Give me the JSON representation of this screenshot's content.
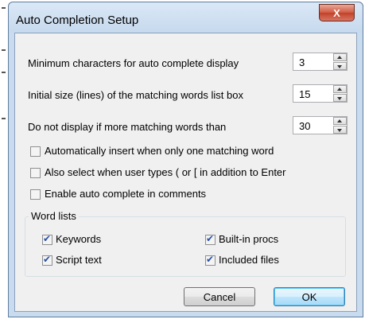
{
  "window": {
    "title": "Auto Completion Setup",
    "close_glyph": "X"
  },
  "settings": [
    {
      "label": "Minimum characters for auto complete display",
      "value": "3"
    },
    {
      "label": "Initial size (lines) of the matching words list box",
      "value": "15"
    },
    {
      "label": "Do not display if more matching words than",
      "value": "30"
    }
  ],
  "options": [
    {
      "label": "Automatically insert when only one matching word",
      "checked": false
    },
    {
      "label": "Also select when user types ( or [ in addition to Enter",
      "checked": false
    },
    {
      "label": "Enable auto complete in comments",
      "checked": false
    }
  ],
  "word_lists": {
    "title": "Word lists",
    "items": [
      {
        "label": "Keywords",
        "checked": true
      },
      {
        "label": "Built-in procs",
        "checked": true
      },
      {
        "label": "Script text",
        "checked": true
      },
      {
        "label": "Included files",
        "checked": true
      }
    ]
  },
  "buttons": {
    "cancel": "Cancel",
    "ok": "OK"
  },
  "check_glyph": "✔"
}
